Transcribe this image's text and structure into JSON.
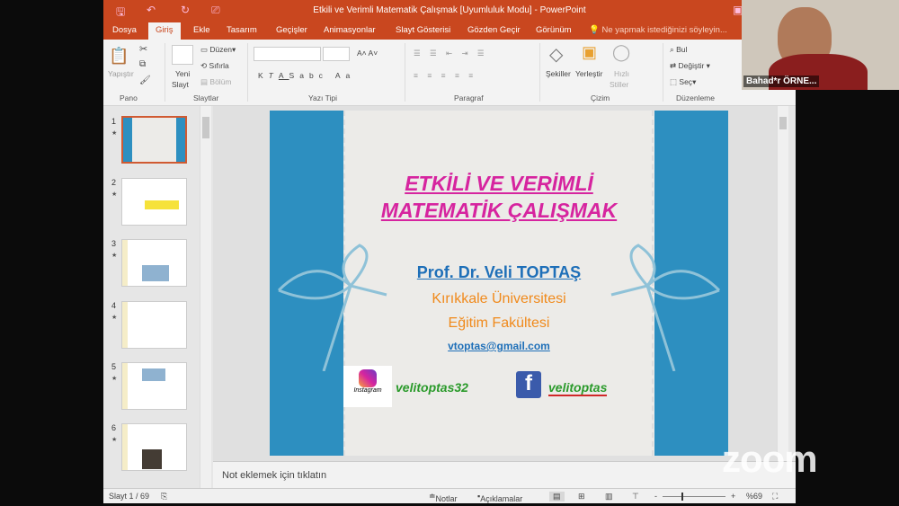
{
  "window": {
    "title": "Etkili ve Verimli Matematik Çalışmak [Uyumluluk Modu] - PowerPoint"
  },
  "tabs": [
    "Dosya",
    "Giriş",
    "Ekle",
    "Tasarım",
    "Geçişler",
    "Animasyonlar",
    "Slayt Gösterisi",
    "Gözden Geçir",
    "Görünüm"
  ],
  "tell_me": "Ne yapmak istediğinizi söyleyin...",
  "ribbon": {
    "pano": {
      "paste": "Yapıştır",
      "label": "Pano"
    },
    "slaytlar": {
      "new": "Yeni",
      "new2": "Slayt",
      "layout": "Düzen",
      "reset": "Sıfırla",
      "section": "Bölüm",
      "label": "Slaytlar"
    },
    "font": {
      "label": "Yazı Tipi",
      "bold": "K",
      "italic": "T",
      "underline": "A",
      "shadow": "S",
      "strike": "abc",
      "case": "Aa"
    },
    "paragraph": {
      "label": "Paragraf"
    },
    "drawing": {
      "shapes": "Şekiller",
      "arrange": "Yerleştir",
      "quick": "Hızlı",
      "quick2": "Stiller",
      "label": "Çizim"
    },
    "editing": {
      "find": "Bul",
      "replace": "Değiştir",
      "select": "Seç",
      "label": "Düzenleme"
    }
  },
  "thumbnails": [
    {
      "n": "1"
    },
    {
      "n": "2"
    },
    {
      "n": "3"
    },
    {
      "n": "4"
    },
    {
      "n": "5"
    },
    {
      "n": "6"
    }
  ],
  "slide": {
    "title1": "ETKİLİ VE VERİMLİ",
    "title2": "MATEMATİK ÇALIŞMAK",
    "author": "Prof. Dr. Veli TOPTAŞ",
    "uni": "Kırıkkale Üniversitesi",
    "faculty": "Eğitim Fakültesi",
    "email": "vtoptas@gmail.com",
    "instagram_logo_text": "Instagram",
    "instagram": "velitoptas32",
    "facebook": "velitoptas"
  },
  "notes_placeholder": "Not eklemek için tıklatın",
  "status": {
    "slide": "Slayt 1 / 69",
    "notes": "Notlar",
    "comments": "Açıklamalar",
    "zoom": "%69",
    "zoom_level": 69
  },
  "participant": {
    "name": "Bahad*r ÖRNE..."
  },
  "watermark": "zoom",
  "colors": {
    "accent": "#c9471f",
    "title": "#d6249f",
    "author": "#1e6fb8",
    "orange": "#f08a1c",
    "band": "#2d8fc0"
  }
}
